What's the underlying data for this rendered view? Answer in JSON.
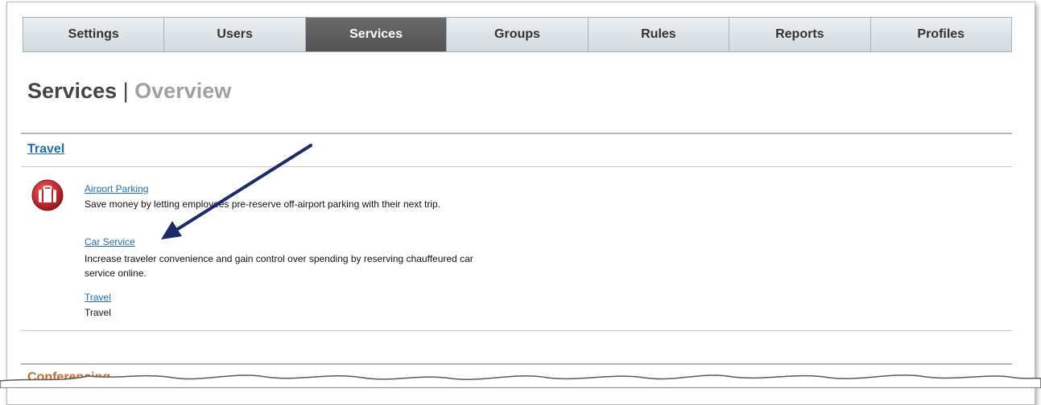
{
  "nav": {
    "tabs": [
      {
        "label": "Settings"
      },
      {
        "label": "Users"
      },
      {
        "label": "Services"
      },
      {
        "label": "Groups"
      },
      {
        "label": "Rules"
      },
      {
        "label": "Reports"
      },
      {
        "label": "Profiles"
      }
    ],
    "active_tab": "Services"
  },
  "header": {
    "title": "Services",
    "separator": "|",
    "subtitle": "Overview"
  },
  "sections": {
    "travel": {
      "label": "Travel",
      "icon": "luggage-icon",
      "services": [
        {
          "name": "Airport Parking",
          "description": "Save money by letting employees pre-reserve off-airport parking with their next trip."
        },
        {
          "name": "Car Service",
          "description": "Increase traveler convenience and gain control over spending by reserving chauffeured car service online."
        },
        {
          "name": "Travel",
          "description": "Travel"
        }
      ]
    },
    "conferencing": {
      "label": "Conferencing"
    }
  },
  "colors": {
    "active_tab": "#5c5c5c",
    "link": "#1f6fb0",
    "annotation_arrow": "#1b2a6b",
    "icon_red": "#c0272d"
  }
}
